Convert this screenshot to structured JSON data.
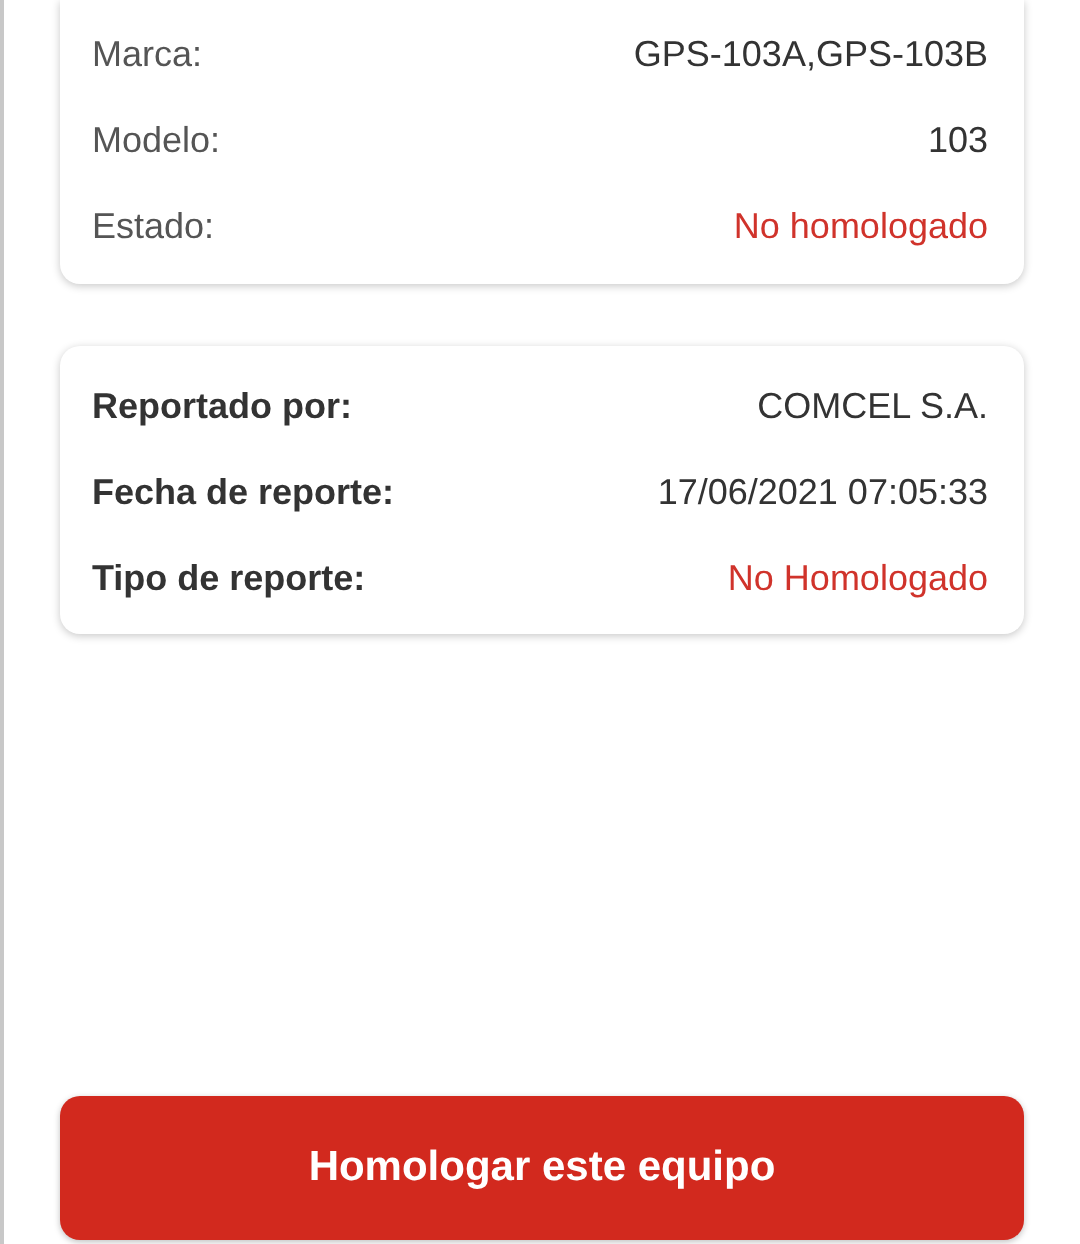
{
  "cards": [
    {
      "bold_labels": false,
      "rows": [
        {
          "label": "Marca:",
          "value": "GPS-103A,GPS-103B",
          "kind": "normal"
        },
        {
          "label": "Modelo:",
          "value": "103",
          "kind": "normal"
        },
        {
          "label": "Estado:",
          "value": "No homologado",
          "kind": "alert"
        }
      ]
    },
    {
      "bold_labels": true,
      "rows": [
        {
          "label": "Reportado por:",
          "value": "COMCEL S.A.",
          "kind": "normal"
        },
        {
          "label": "Fecha de reporte:",
          "value": "17/06/2021 07:05:33",
          "kind": "normal"
        },
        {
          "label": "Tipo de reporte:",
          "value": "No Homologado",
          "kind": "alert"
        }
      ]
    }
  ],
  "button": {
    "label": "Homologar este equipo"
  }
}
